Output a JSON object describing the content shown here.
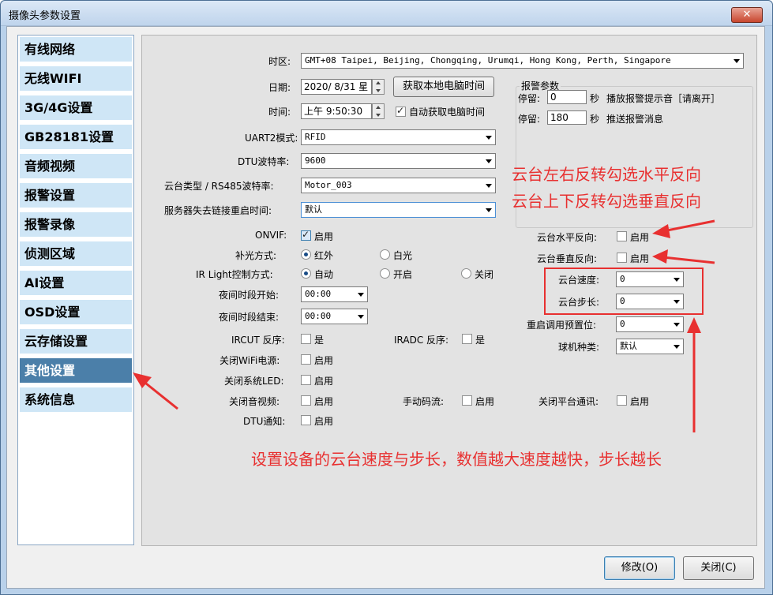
{
  "window": {
    "title": "摄像头参数设置",
    "close_glyph": "✕"
  },
  "sidebar": {
    "items": [
      {
        "label": "有线网络",
        "active": false
      },
      {
        "label": "无线WIFI",
        "active": false
      },
      {
        "label": "3G/4G设置",
        "active": false
      },
      {
        "label": "GB28181设置",
        "active": false
      },
      {
        "label": "音频视频",
        "active": false
      },
      {
        "label": "报警设置",
        "active": false
      },
      {
        "label": "报警录像",
        "active": false
      },
      {
        "label": "侦测区域",
        "active": false
      },
      {
        "label": "AI设置",
        "active": false
      },
      {
        "label": "OSD设置",
        "active": false
      },
      {
        "label": "云存储设置",
        "active": false
      },
      {
        "label": "其他设置",
        "active": true
      },
      {
        "label": "系统信息",
        "active": false
      }
    ]
  },
  "form": {
    "timezone_label": "时区:",
    "timezone_value": "GMT+08 Taipei, Beijing, Chongqing, Urumqi, Hong Kong, Perth, Singapore",
    "date_label": "日期:",
    "date_value": "2020/ 8/31 星",
    "get_pc_time_button": "获取本地电脑时间",
    "time_label": "时间:",
    "time_value": "上午  9:50:30",
    "auto_get_pc_time_label": "自动获取电脑时间",
    "uart2_label": "UART2模式:",
    "uart2_value": "RFID",
    "dtu_baud_label": "DTU波特率:",
    "dtu_baud_value": "9600",
    "ptz_type_label": "云台类型 / RS485波特率:",
    "ptz_type_value": "Motor_003",
    "server_loss_label": "服务器失去链接重启时间:",
    "server_loss_value": "默认",
    "onvif_label": "ONVIF:",
    "onvif_opt": "启用",
    "fill_light_label": "补光方式:",
    "fill_light_opts": [
      "红外",
      "白光"
    ],
    "ir_light_label": "IR Light控制方式:",
    "ir_light_opts": [
      "自动",
      "开启",
      "关闭"
    ],
    "night_start_label": "夜间时段开始:",
    "night_start_value": "00:00",
    "night_end_label": "夜间时段结束:",
    "night_end_value": "00:00",
    "ircut_label": "IRCUT 反序:",
    "ircut_opt": "是",
    "iradc_label": "IRADC 反序:",
    "iradc_opt": "是",
    "wifi_power_label": "关闭WiFi电源:",
    "wifi_power_opt": "启用",
    "system_led_label": "关闭系统LED:",
    "system_led_opt": "启用",
    "close_av_label": "关闭音视频:",
    "close_av_opt": "启用",
    "manual_stream_label": "手动码流:",
    "manual_stream_opt": "启用",
    "close_platform_label": "关闭平台通讯:",
    "close_platform_opt": "启用",
    "dtu_notify_label": "DTU通知:",
    "dtu_notify_opt": "启用"
  },
  "alarm_group": {
    "title": "报警参数",
    "stay1_label": "停留:",
    "stay1_value": "0",
    "stay1_unit": "秒",
    "stay1_desc": "播放报警提示音［请离开］",
    "stay2_label": "停留:",
    "stay2_value": "180",
    "stay2_unit": "秒",
    "stay2_desc": "推送报警消息"
  },
  "ptz": {
    "h_reverse_label": "云台水平反向:",
    "h_reverse_opt": "启用",
    "v_reverse_label": "云台垂直反向:",
    "v_reverse_opt": "启用",
    "speed_label": "云台速度:",
    "speed_value": "0",
    "step_label": "云台步长:",
    "step_value": "0",
    "preset_label": "重启调用预置位:",
    "preset_value": "0",
    "dome_type_label": "球机种类:",
    "dome_type_value": "默认"
  },
  "annotations": {
    "line1": "云台左右反转勾选水平反向",
    "line2": "云台上下反转勾选垂直反向",
    "line3": "设置设备的云台速度与步长，数值越大速度越快，步长越长",
    "color": "#e83030"
  },
  "footer": {
    "modify_button": "修改(O)",
    "close_button": "关闭(C)"
  }
}
